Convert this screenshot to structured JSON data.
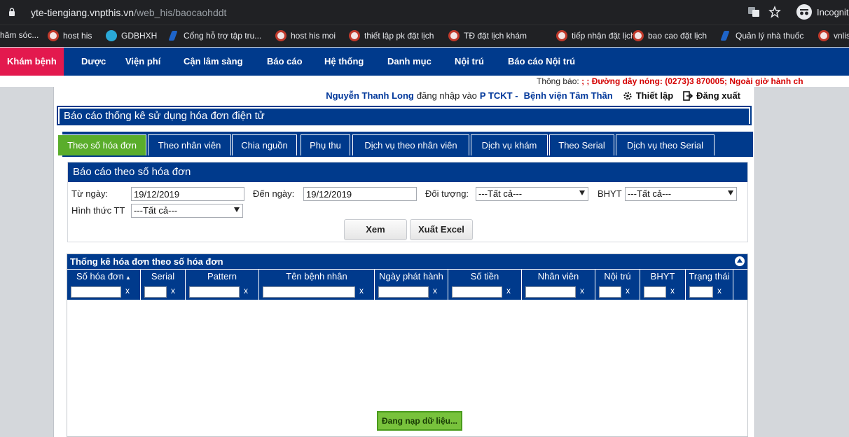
{
  "browser": {
    "url_host": "yte-tiengiang.vnpthis.vn",
    "url_path": "/web_his/baocaohddt",
    "incognito_label": "Incognito",
    "icons": [
      "lock-icon",
      "translate-icon",
      "star-icon",
      "incognito-icon"
    ]
  },
  "bookmarks": [
    {
      "label": "hăm sóc...",
      "icon": "none"
    },
    {
      "label": "host his",
      "icon": "his"
    },
    {
      "label": "GDBHXH",
      "icon": "gd"
    },
    {
      "label": "Cổng hỗ trợ tập tru...",
      "icon": "blue"
    },
    {
      "label": "host his moi",
      "icon": "his"
    },
    {
      "label": "thiết lập pk đặt lịch",
      "icon": "his"
    },
    {
      "label": "TĐ đặt lịch khám",
      "icon": "his"
    },
    {
      "label": "tiếp nhận đặt lịch",
      "icon": "his"
    },
    {
      "label": "bao cao đặt lịch",
      "icon": "his"
    },
    {
      "label": "Quản lý nhà thuốc",
      "icon": "blue"
    },
    {
      "label": "vnlis",
      "icon": "his"
    }
  ],
  "nav": {
    "items": [
      "Khám bệnh",
      "Dược",
      "Viện phí",
      "Cận lâm sàng",
      "Báo cáo",
      "Hệ thống",
      "Danh mục",
      "Nội trú",
      "Báo cáo Nội trú"
    ],
    "active_color": "#e3194e"
  },
  "ticker": {
    "label": "Thông báo:",
    "text": "; ; Đường dây nóng: (0273)3 870005; Ngoài giờ hành ch"
  },
  "user": {
    "name": "Nguyễn Thanh Long",
    "login_text": "đăng nhập vào",
    "dept": "P TCKT -",
    "hospital": "Bệnh viện Tâm Thần",
    "settings_label": "Thiết lập",
    "logout_label": "Đăng xuất"
  },
  "page_title": "Báo cáo thống kê sử dụng hóa đơn điện tử",
  "tabs": [
    "Theo số hóa đơn",
    "Theo nhân viên",
    "Chia nguồn",
    "Phụ thu",
    "Dịch vụ theo nhân viên",
    "Dịch vụ khám",
    "Theo Serial",
    "Dịch vụ theo Serial"
  ],
  "tab_active_color": "#5aad2b",
  "form": {
    "title": "Báo cáo theo số hóa đơn",
    "from_label": "Từ ngày:",
    "from_value": "19/12/2019",
    "to_label": "Đến ngày:",
    "to_value": "19/12/2019",
    "object_label": "Đối tượng:",
    "object_value": "---Tất cả---",
    "bhyt_label": "BHYT",
    "bhyt_value": "---Tất cả---",
    "payment_label": "Hình thức TT",
    "payment_value": "---Tất cả---",
    "view_button": "Xem",
    "export_button": "Xuất Excel"
  },
  "grid": {
    "caption": "Thống kê hóa đơn theo số hóa đơn",
    "columns": [
      "Số hóa đơn",
      "Serial",
      "Pattern",
      "Tên bệnh nhân",
      "Ngày phát hành",
      "Số tiền",
      "Nhân viên",
      "Nội trú",
      "BHYT",
      "Trạng thái"
    ],
    "sort_column": "Số hóa đơn",
    "clear_label": "x",
    "loading_text": "Đang nạp dữ liệu..."
  },
  "colors": {
    "primary": "#003a8c",
    "loading_bg": "#78c23c",
    "hotline": "#d40000"
  }
}
